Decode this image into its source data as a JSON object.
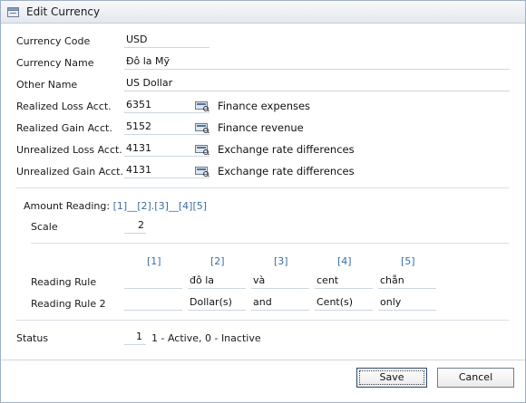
{
  "window": {
    "title": "Edit Currency",
    "title_icon": "edit-currency-icon"
  },
  "fields": {
    "currency_code": {
      "label": "Currency Code",
      "value": "USD"
    },
    "currency_name": {
      "label": "Currency Name",
      "value": "Đô la Mỹ"
    },
    "other_name": {
      "label": "Other Name",
      "value": "US Dollar"
    }
  },
  "accounts": [
    {
      "label": "Realized Loss Acct.",
      "value": "6351",
      "desc": "Finance expenses"
    },
    {
      "label": "Realized Gain Acct.",
      "value": "5152",
      "desc": "Finance revenue"
    },
    {
      "label": "Unrealized Loss Acct.",
      "value": "4131",
      "desc": "Exchange rate differences"
    },
    {
      "label": "Unrealized Gain Acct.",
      "value": "4131",
      "desc": "Exchange rate differences"
    }
  ],
  "amount_reading": {
    "label": "Amount Reading:",
    "links": [
      "[1]",
      "[2]",
      "[3]",
      "[4]",
      "[5]"
    ],
    "separators": [
      "__",
      ".",
      "__",
      ""
    ],
    "scale_label": "Scale",
    "scale_value": "2"
  },
  "reading": {
    "columns": [
      "[1]",
      "[2]",
      "[3]",
      "[4]",
      "[5]"
    ],
    "rule1_label": "Reading Rule",
    "rule1": [
      "",
      "đô la",
      "và",
      "cent",
      "chẵn"
    ],
    "rule2_label": "Reading Rule 2",
    "rule2": [
      "",
      "Dollar(s)",
      "and",
      "Cent(s)",
      "only"
    ]
  },
  "status": {
    "label": "Status",
    "value": "1",
    "hint": "1 - Active, 0 - Inactive"
  },
  "buttons": {
    "save": "Save",
    "cancel": "Cancel"
  }
}
